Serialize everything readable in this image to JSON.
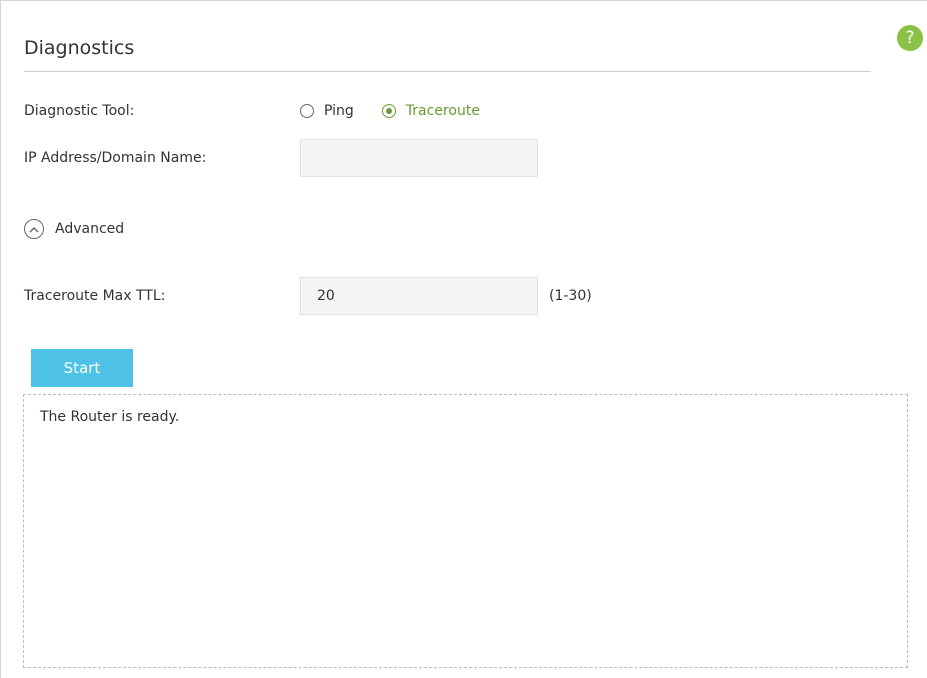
{
  "page": {
    "title": "Diagnostics",
    "help_label": "?"
  },
  "diagnostic_tool": {
    "label": "Diagnostic Tool:",
    "options": [
      {
        "label": "Ping",
        "selected": false
      },
      {
        "label": "Traceroute",
        "selected": true
      }
    ]
  },
  "ip_address": {
    "label": "IP Address/Domain Name:",
    "value": "",
    "placeholder": ""
  },
  "advanced": {
    "label": "Advanced",
    "expanded": true
  },
  "max_ttl": {
    "label": "Traceroute Max TTL:",
    "value": "20",
    "range_hint": "(1-30)"
  },
  "actions": {
    "start_label": "Start"
  },
  "output": {
    "text": "The Router is ready."
  },
  "colors": {
    "accent_green": "#6a9a2f",
    "help_green": "#8ac146",
    "button_blue": "#4dc2e6"
  }
}
